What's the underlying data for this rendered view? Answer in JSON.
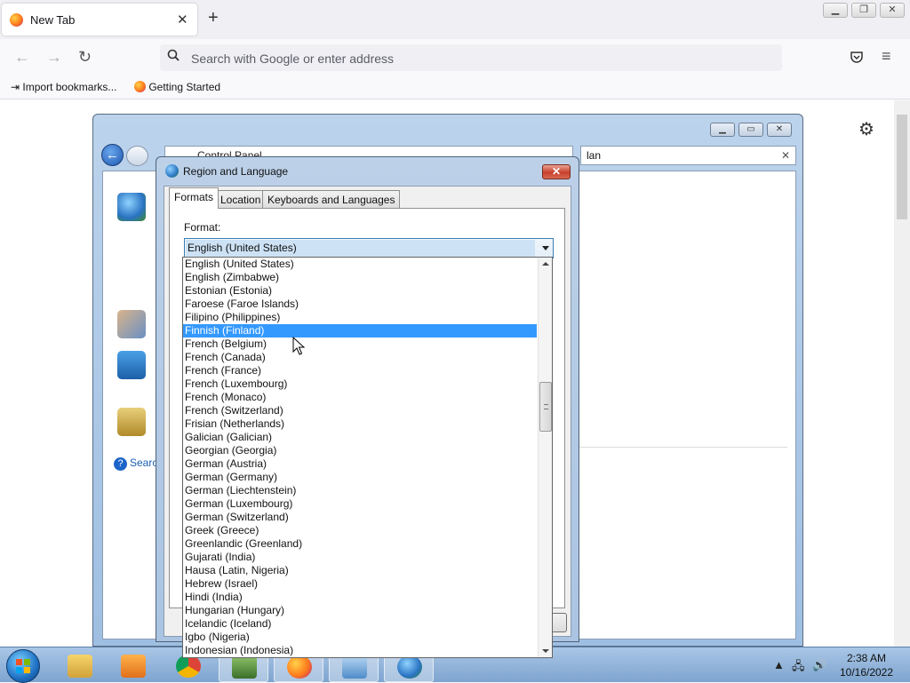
{
  "browser": {
    "tab_title": "New Tab",
    "new_tab_symbol": "+",
    "url_placeholder": "Search with Google or enter address",
    "bookmarks": [
      "Import bookmarks...",
      "Getting Started"
    ]
  },
  "control_panel": {
    "address": "Control Panel",
    "search_value": "lan",
    "help_link": "Search"
  },
  "dialog": {
    "title": "Region and Language",
    "tabs": [
      "Formats",
      "Location",
      "Keyboards and Languages"
    ],
    "format_label": "Format:",
    "format_selected": "English (United States)",
    "highlighted_index": 5,
    "format_options": [
      "English (United States)",
      "English (Zimbabwe)",
      "Estonian (Estonia)",
      "Faroese (Faroe Islands)",
      "Filipino (Philippines)",
      "Finnish (Finland)",
      "French (Belgium)",
      "French (Canada)",
      "French (France)",
      "French (Luxembourg)",
      "French (Monaco)",
      "French (Switzerland)",
      "Frisian (Netherlands)",
      "Galician (Galician)",
      "Georgian (Georgia)",
      "German (Austria)",
      "German (Germany)",
      "German (Liechtenstein)",
      "German (Luxembourg)",
      "German (Switzerland)",
      "Greek (Greece)",
      "Greenlandic (Greenland)",
      "Gujarati (India)",
      "Hausa (Latin, Nigeria)",
      "Hebrew (Israel)",
      "Hindi (India)",
      "Hungarian (Hungary)",
      "Icelandic (Iceland)",
      "Igbo (Nigeria)",
      "Indonesian (Indonesia)"
    ]
  },
  "taskbar": {
    "time": "2:38 AM",
    "date": "10/16/2022",
    "items": [
      "explorer-icon",
      "media-player-icon",
      "chrome-icon",
      "network-icon",
      "firefox-icon",
      "control-panel-icon",
      "region-icon"
    ]
  },
  "colors": {
    "highlight": "#3399ff",
    "taskbar": "#8fb1d8",
    "dialog_frame": "#aac4e2"
  }
}
